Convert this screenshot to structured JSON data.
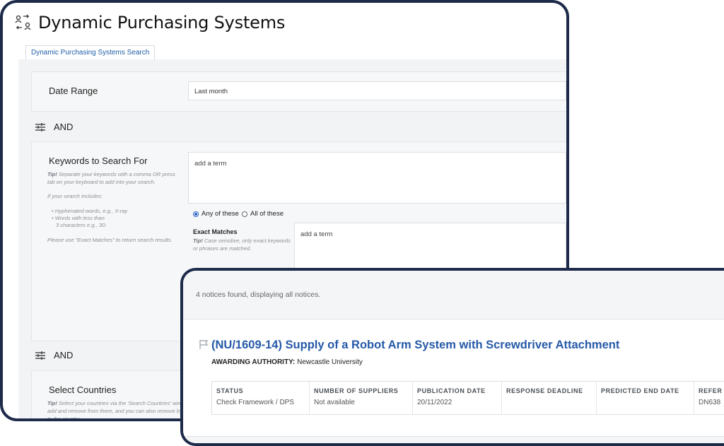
{
  "page": {
    "title": "Dynamic Purchasing Systems"
  },
  "tabs": [
    {
      "label": "Dynamic Purchasing Systems Search"
    }
  ],
  "date_range": {
    "label": "Date Range",
    "value": "Last month"
  },
  "and_label": "AND",
  "keywords": {
    "label": "Keywords to Search For",
    "placeholder": "add a term",
    "tip_prefix": "Tip!",
    "tip_text": "Separate your keywords with a comma OR press tab on your keyboard to add into your search.",
    "includes_intro": "If your search includes:",
    "bullets": [
      "• Hyphenated words, e.g., X-ray",
      "• Words with less than",
      "3 characters e.g., 3D"
    ],
    "exact_note": "Please use \"Exact Matches\" to return search results.",
    "match_any": "Any of these",
    "match_all": "All of these"
  },
  "exact_matches": {
    "label": "Exact Matches",
    "tip_prefix": "Tip!",
    "tip_text": "Case sensitive, only exact keywords or phrases are matched.",
    "placeholder": "add a term"
  },
  "countries": {
    "label": "Select Countries",
    "tip_prefix": "Tip!",
    "tip_line1": "Select your countries via the 'Search Countries' wind",
    "tip_line2": "add and remove from there, and you can also remove by",
    "tip_line3": "to the country."
  },
  "results": {
    "count_text": "4 notices found, displaying all notices.",
    "notice": {
      "title": "(NU/1609-14) Supply of a Robot Arm System with Screwdriver Attachment",
      "authority_label": "AWARDING AUTHORITY:",
      "authority_value": "Newcastle University",
      "columns": [
        {
          "header": "STATUS",
          "value": "Check Framework / DPS"
        },
        {
          "header": "NUMBER OF SUPPLIERS",
          "value": "Not available"
        },
        {
          "header": "PUBLICATION DATE",
          "value": "20/11/2022"
        },
        {
          "header": "RESPONSE DEADLINE",
          "value": ""
        },
        {
          "header": "PREDICTED END DATE",
          "value": ""
        },
        {
          "header": "REFER",
          "value": "DN638"
        }
      ]
    }
  },
  "colors": {
    "frame": "#1d2a4a",
    "link": "#2659a8",
    "accent": "#1f5fa8"
  },
  "icons": [
    "purchasing-systems-icon",
    "filter-sliders-icon",
    "flag-icon"
  ]
}
